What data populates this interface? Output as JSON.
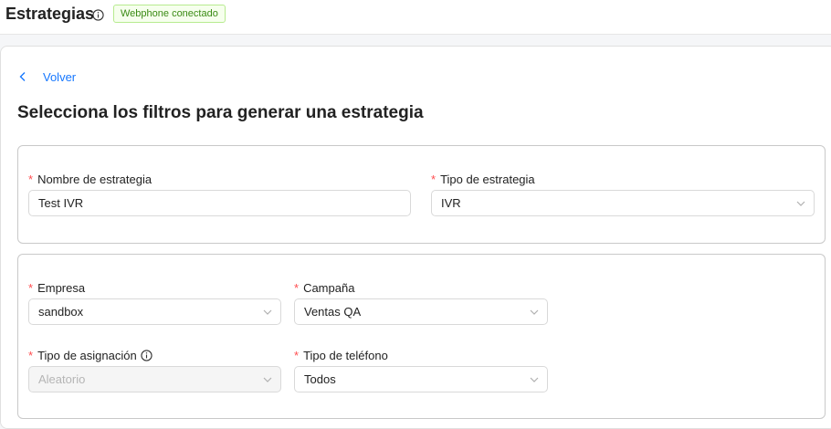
{
  "header": {
    "title": "Estrategias",
    "status_badge": "Webphone conectado"
  },
  "nav": {
    "back_label": "Volver"
  },
  "main": {
    "heading": "Selecciona los filtros para generar una estrategia"
  },
  "form": {
    "strategy_name": {
      "label": "Nombre de estrategia",
      "value": "Test IVR"
    },
    "strategy_type": {
      "label": "Tipo de estrategia",
      "value": "IVR"
    },
    "company": {
      "label": "Empresa",
      "value": "sandbox"
    },
    "campaign": {
      "label": "Campaña",
      "value": "Ventas QA"
    },
    "assignment_type": {
      "label": "Tipo de asignación",
      "value": "Aleatorio",
      "disabled": true
    },
    "phone_type": {
      "label": "Tipo de teléfono",
      "value": "Todos"
    }
  },
  "icons": {
    "info": "info-circle-icon",
    "back": "chevron-left-icon",
    "dropdown": "chevron-down-icon"
  },
  "colors": {
    "accent": "#1677ff",
    "required": "#ff4d4f",
    "badge_text": "#3a8a14",
    "badge_bg": "#f6ffed",
    "badge_border": "#b7eb8f"
  }
}
